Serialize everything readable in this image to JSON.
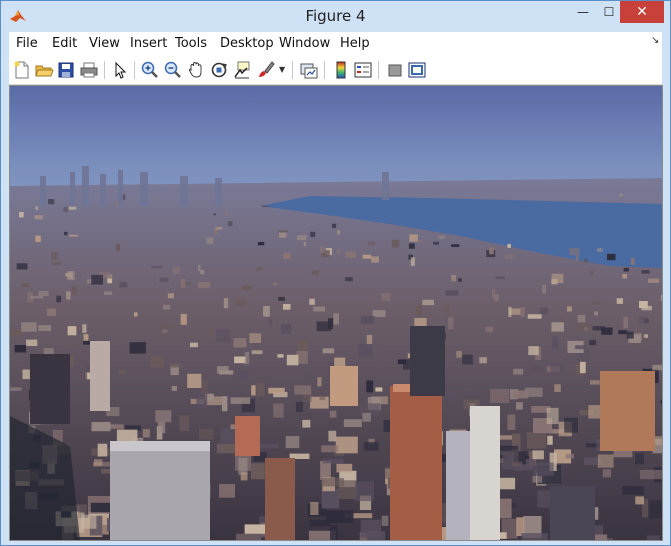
{
  "window": {
    "title": "Figure 4",
    "controls": {
      "minimize": "—",
      "maximize": "☐",
      "close": "✕"
    }
  },
  "menubar": {
    "items": [
      {
        "label": "File"
      },
      {
        "label": "Edit"
      },
      {
        "label": "View"
      },
      {
        "label": "Insert"
      },
      {
        "label": "Tools"
      },
      {
        "label": "Desktop"
      },
      {
        "label": "Window"
      },
      {
        "label": "Help"
      }
    ],
    "dock_glyph": "↘"
  },
  "toolbar": {
    "tools": [
      "new-figure-icon",
      "open-file-icon",
      "save-icon",
      "print-icon",
      "edit-plot-arrow-icon",
      "zoom-in-icon",
      "zoom-out-icon",
      "pan-hand-icon",
      "rotate-3d-icon",
      "data-cursor-icon",
      "brush-icon",
      "brush-dropdown-icon",
      "link-plot-icon",
      "insert-colorbar-icon",
      "insert-legend-icon",
      "hide-plot-tools-icon",
      "show-plot-tools-icon"
    ]
  },
  "figure": {
    "content": "aerial-city-photo",
    "colors": {
      "sky_top": "#5a6aa6",
      "sky_bottom": "#8aa0c8",
      "river": "#4a6aa2",
      "city_dark": "#2e2c3c",
      "city_mid": "#6a5a5a",
      "city_light": "#b69a86"
    }
  }
}
